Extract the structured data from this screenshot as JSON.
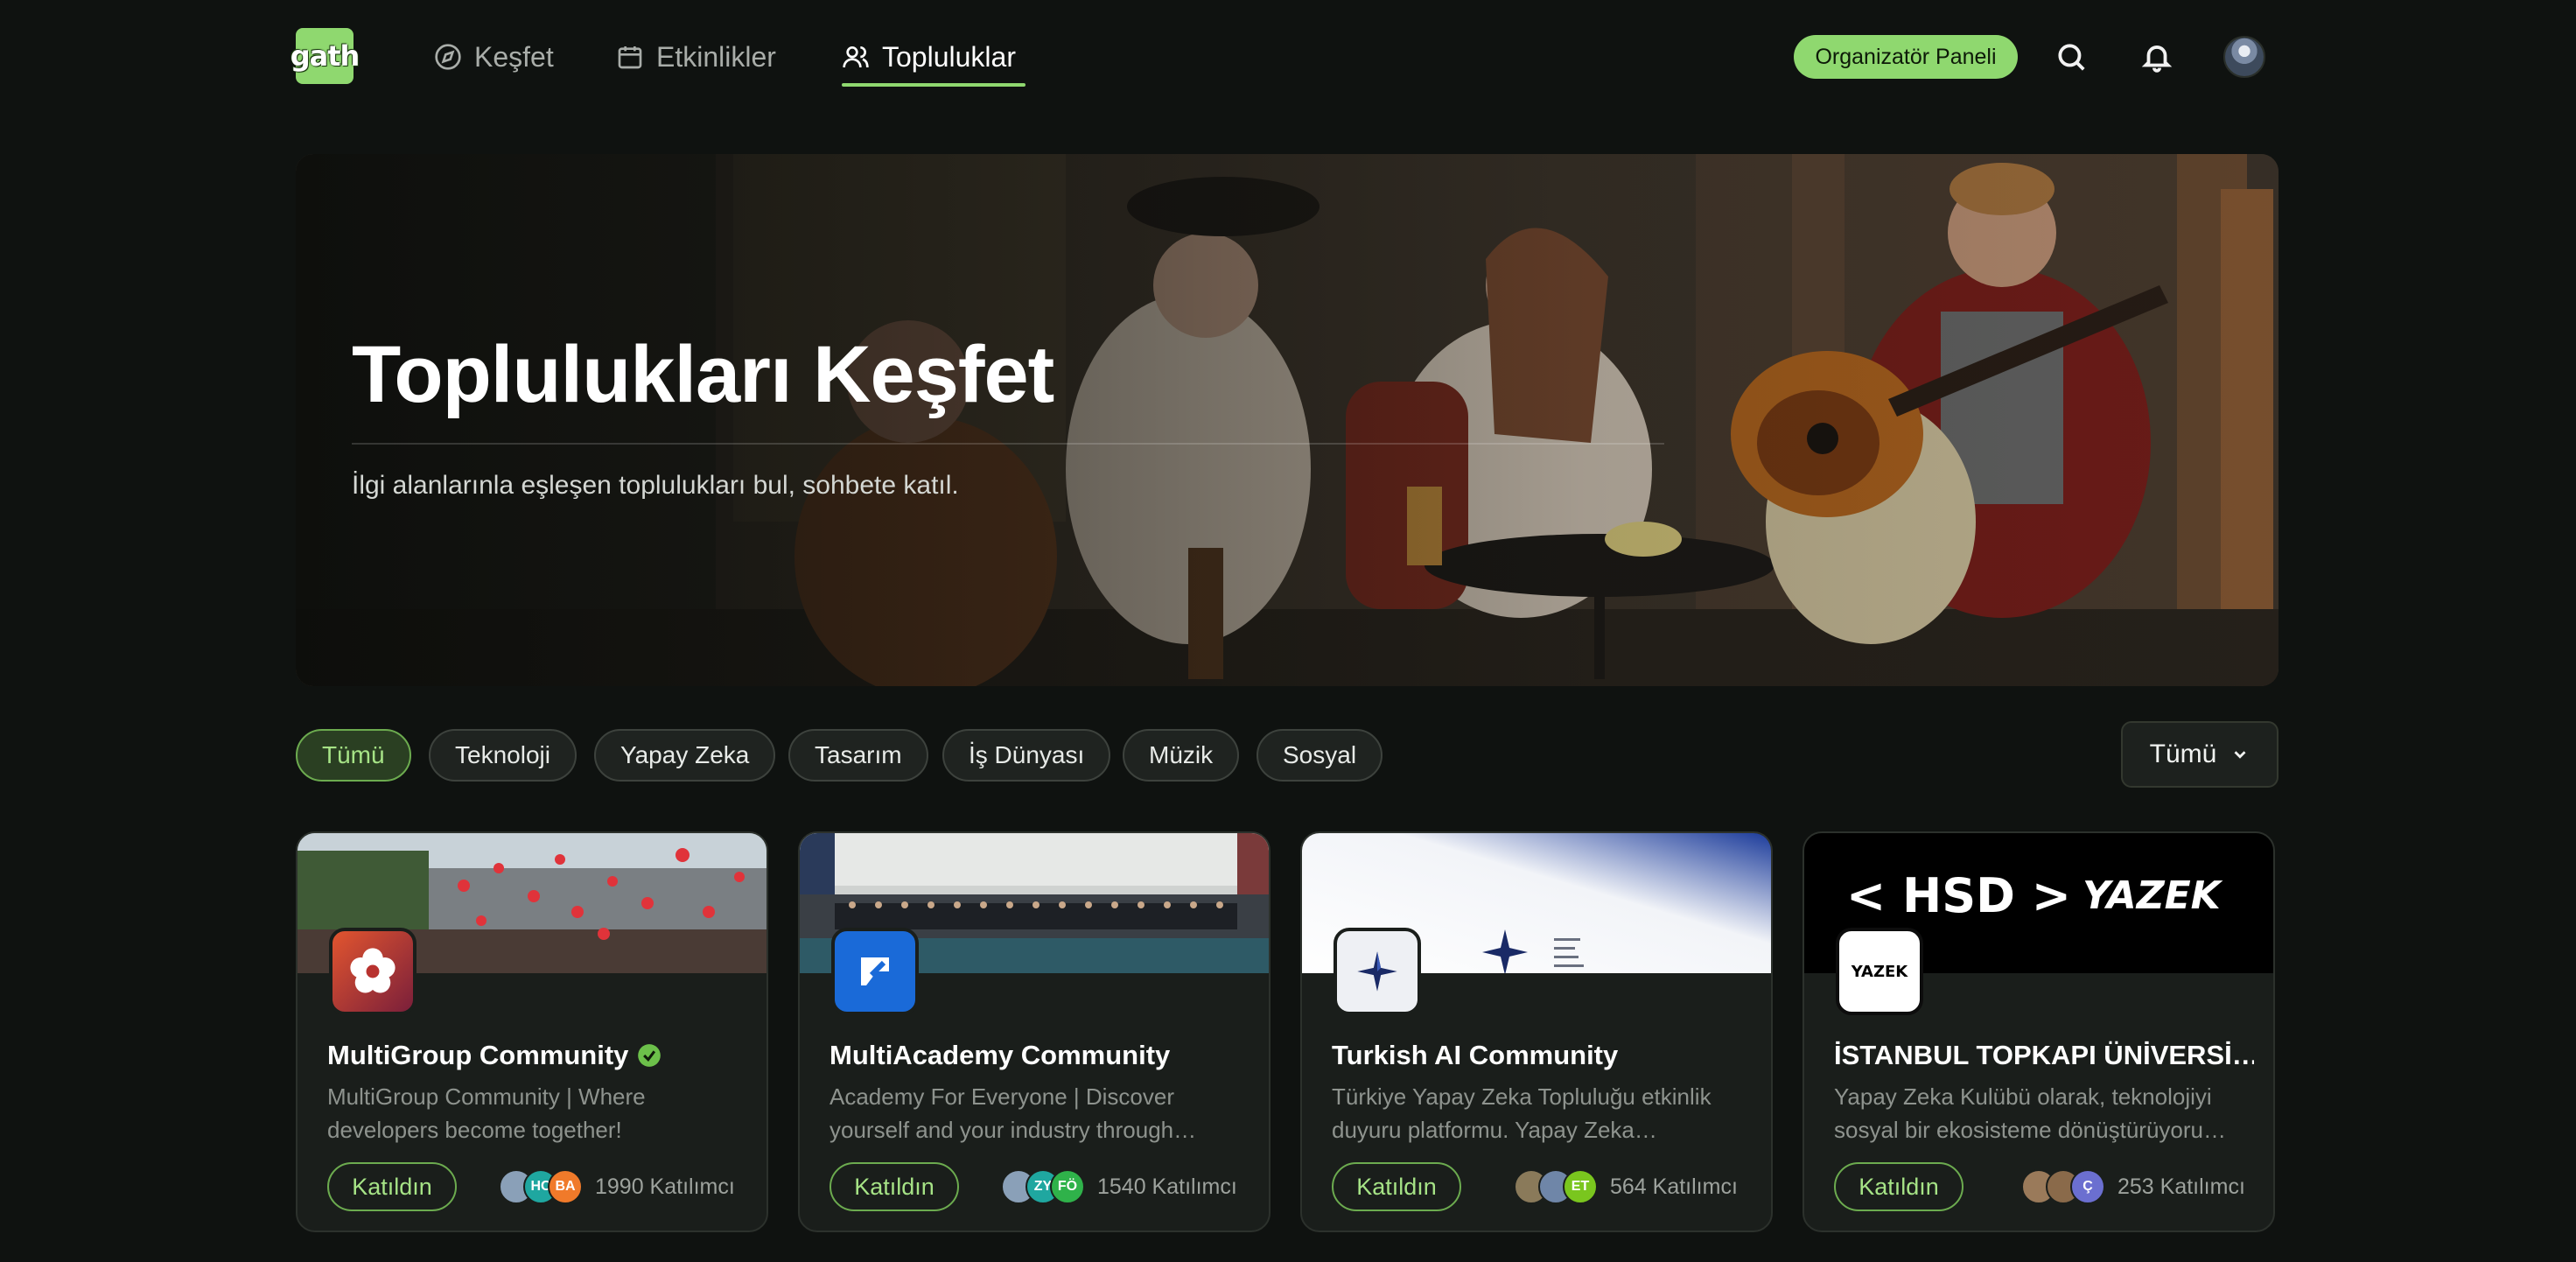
{
  "nav": {
    "logo_text": "gath",
    "links": [
      {
        "label": "Keşfet",
        "icon": "compass-icon"
      },
      {
        "label": "Etkinlikler",
        "icon": "calendar-icon"
      },
      {
        "label": "Topluluklar",
        "icon": "users-icon",
        "active": true
      }
    ],
    "organizer_label": "Organizatör Paneli",
    "accent": "#8fd86f"
  },
  "hero": {
    "title": "Toplulukları Keşfet",
    "subtitle": "İlgi alanlarınla eşleşen toplulukları bul, sohbete katıl."
  },
  "filters": {
    "chips": [
      "Tümü",
      "Teknoloji",
      "Yapay Zeka",
      "Tasarım",
      "İş Dünyası",
      "Müzik",
      "Sosyal"
    ],
    "active": "Tümü",
    "sort_value": "Tümü"
  },
  "cards": [
    {
      "title": "MultiGroup Community",
      "verified": true,
      "description": "MultiGroup Community | Where developers become together!",
      "join_label": "Katıldın",
      "avatars": [
        {
          "initials": "",
          "color": "#8aa0b8"
        },
        {
          "initials": "HC",
          "color": "#1fa7a0"
        },
        {
          "initials": "BA",
          "color": "#f07a2a"
        }
      ],
      "participants": "1990 Katılımcı"
    },
    {
      "title": "MultiAcademy Community",
      "verified": false,
      "description": "Academy For Everyone | Discover yourself and your industry through…",
      "join_label": "Katıldın",
      "avatars": [
        {
          "initials": "",
          "color": "#8aa0b8"
        },
        {
          "initials": "ZY",
          "color": "#1fa7a0"
        },
        {
          "initials": "FÖ",
          "color": "#2fb24a"
        }
      ],
      "participants": "1540 Katılımcı"
    },
    {
      "title": "Turkish AI Community",
      "verified": false,
      "description": "Türkiye Yapay Zeka Topluluğu etkinlik duyuru platformu. Yapay Zeka…",
      "join_label": "Katıldın",
      "avatars": [
        {
          "initials": "",
          "color": "#8a7a5a"
        },
        {
          "initials": "",
          "color": "#6f86a8"
        },
        {
          "initials": "ET",
          "color": "#7ac61e"
        }
      ],
      "participants": "564 Katılımcı"
    },
    {
      "title": "İSTANBUL TOPKAPI ÜNİVERSİ…",
      "verified": false,
      "description": "Yapay Zeka Kulübü olarak, teknolojiyi sosyal bir ekosisteme dönüştürüyoru…",
      "join_label": "Katıldın",
      "avatars": [
        {
          "initials": "",
          "color": "#9a7a5a"
        },
        {
          "initials": "",
          "color": "#8a6a4a"
        },
        {
          "initials": "Ç",
          "color": "#6b6fd0"
        }
      ],
      "participants": "253 Katılımcı",
      "cover_text_left": "< HSD >",
      "cover_text_right": "YAZEK",
      "logo_text": "YAZEK"
    }
  ]
}
